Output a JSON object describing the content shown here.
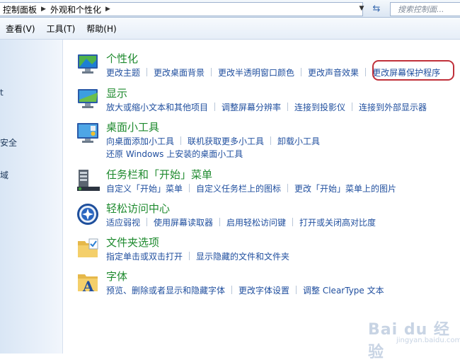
{
  "address": {
    "crumbs": [
      "控制面板",
      "外观和个性化"
    ],
    "search_placeholder": "搜索控制面..."
  },
  "menubar": {
    "items": [
      "查看(V)",
      "工具(T)",
      "帮助(H)"
    ]
  },
  "left_pane": {
    "items": [
      "t",
      "安全",
      "域"
    ]
  },
  "categories": [
    {
      "title": "个性化",
      "icon": "personalization-icon",
      "links": [
        [
          "更改主题",
          "更改桌面背景",
          "更改半透明窗口颜色",
          "更改声音效果",
          "更改屏幕保护程序"
        ]
      ]
    },
    {
      "title": "显示",
      "icon": "display-icon",
      "links": [
        [
          "放大或缩小文本和其他项目",
          "调整屏幕分辨率",
          "连接到投影仪",
          "连接到外部显示器"
        ]
      ]
    },
    {
      "title": "桌面小工具",
      "icon": "gadgets-icon",
      "links": [
        [
          "向桌面添加小工具",
          "联机获取更多小工具",
          "卸载小工具"
        ],
        [
          "还原 Windows 上安装的桌面小工具"
        ]
      ]
    },
    {
      "title": "任务栏和「开始」菜单",
      "icon": "taskbar-icon",
      "links": [
        [
          "自定义「开始」菜单",
          "自定义任务栏上的图标",
          "更改「开始」菜单上的图片"
        ]
      ]
    },
    {
      "title": "轻松访问中心",
      "icon": "ease-of-access-icon",
      "links": [
        [
          "适应弱视",
          "使用屏幕读取器",
          "启用轻松访问键",
          "打开或关闭高对比度"
        ]
      ]
    },
    {
      "title": "文件夹选项",
      "icon": "folder-options-icon",
      "links": [
        [
          "指定单击或双击打开",
          "显示隐藏的文件和文件夹"
        ]
      ]
    },
    {
      "title": "字体",
      "icon": "fonts-icon",
      "links": [
        [
          "预览、删除或者显示和隐藏字体",
          "更改字体设置",
          "调整 ClearType 文本"
        ]
      ]
    }
  ],
  "watermark": {
    "text": "Bai du 经验",
    "sub": "jingyan.baidu.com"
  }
}
